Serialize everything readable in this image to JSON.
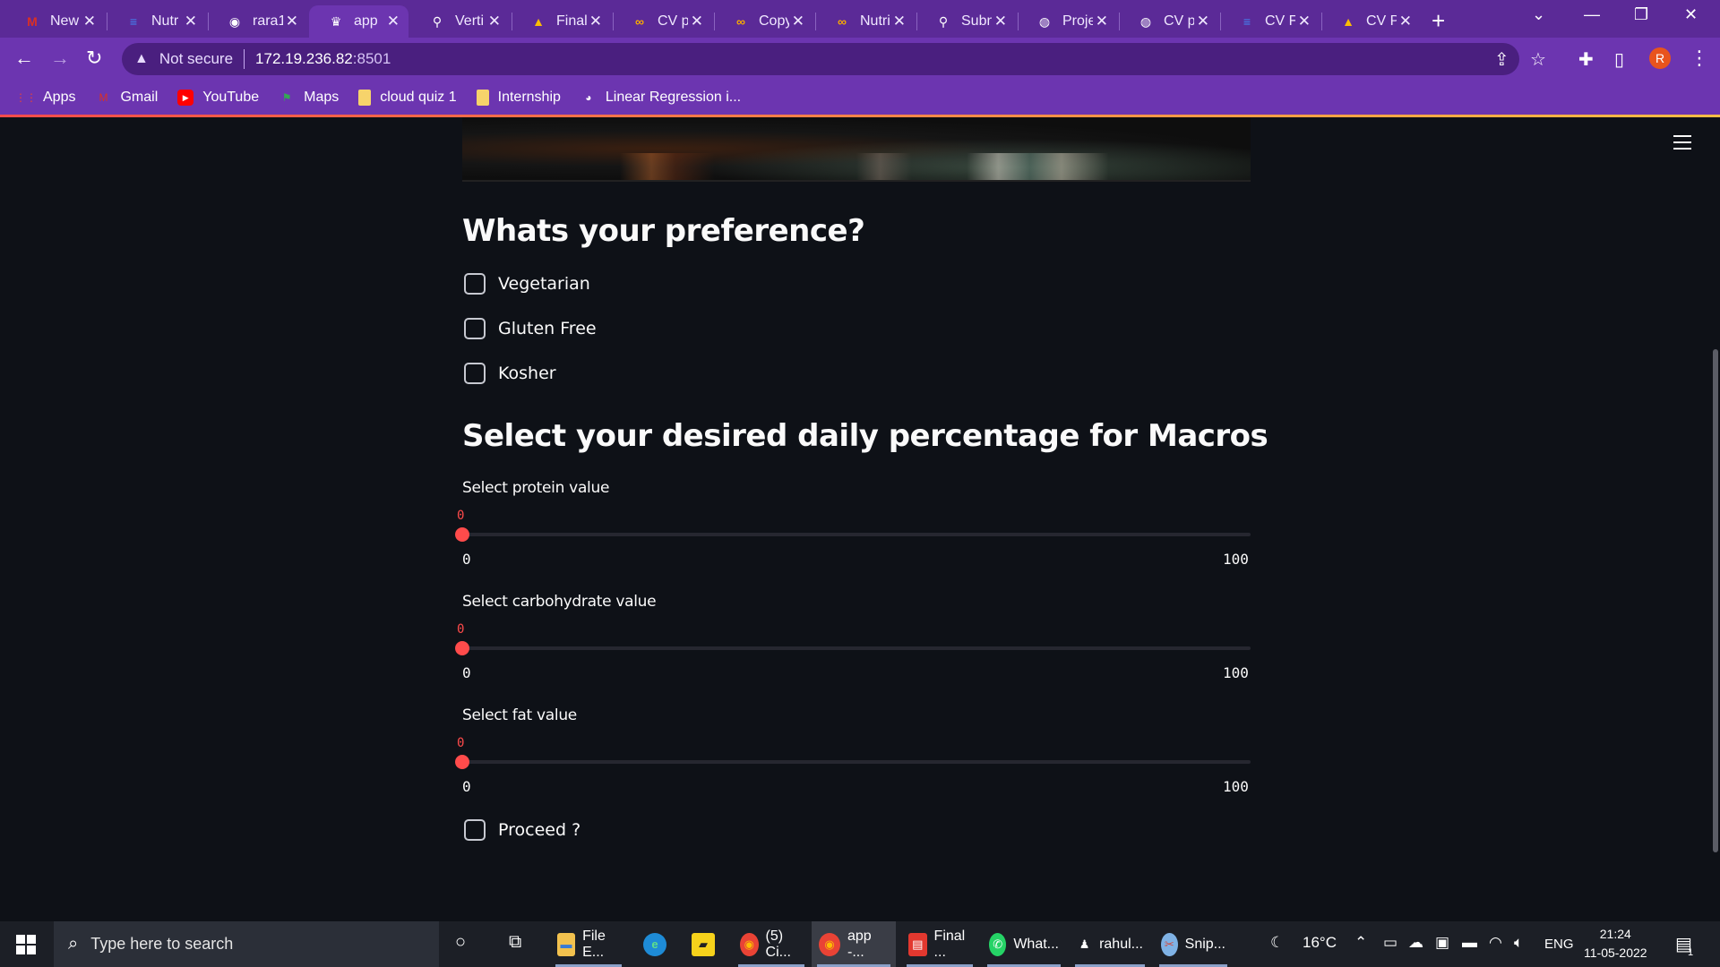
{
  "browser": {
    "tabs": [
      {
        "label": "New",
        "icon": "gmail-icon",
        "color": "#d93025"
      },
      {
        "label": "Nutr",
        "icon": "docs-icon",
        "color": "#4285f4"
      },
      {
        "label": "rara1",
        "icon": "github-icon",
        "color": "#ffffff"
      },
      {
        "label": "app",
        "icon": "streamlit-icon",
        "color": "#ffffff"
      },
      {
        "label": "Verti",
        "icon": "pin-icon",
        "color": "#ffffff"
      },
      {
        "label": "Final",
        "icon": "drive-icon",
        "color": "#fbbc04"
      },
      {
        "label": "CV p",
        "icon": "colab-icon",
        "color": "#f9ab00"
      },
      {
        "label": "Copy",
        "icon": "colab-icon",
        "color": "#f9ab00"
      },
      {
        "label": "Nutri",
        "icon": "colab-icon",
        "color": "#f9ab00"
      },
      {
        "label": "Subn",
        "icon": "pin-icon",
        "color": "#ffffff"
      },
      {
        "label": "Proje",
        "icon": "globe-icon",
        "color": "#ffffff"
      },
      {
        "label": "CV p",
        "icon": "globe-icon",
        "color": "#ffffff"
      },
      {
        "label": "CV F",
        "icon": "docs-icon",
        "color": "#4285f4"
      },
      {
        "label": "CV P",
        "icon": "drive-icon",
        "color": "#fbbc04"
      }
    ],
    "active_tab": 3,
    "address": {
      "security": "Not secure",
      "host": "172.19.236.82",
      "port": ":8501"
    },
    "profile_initial": "R",
    "bookmarks": [
      {
        "label": "Apps",
        "icon": "apps-grid-icon",
        "color": "#ea4335"
      },
      {
        "label": "Gmail",
        "icon": "gmail-icon",
        "color": "#d93025"
      },
      {
        "label": "YouTube",
        "icon": "youtube-icon",
        "color": "#ff0000"
      },
      {
        "label": "Maps",
        "icon": "maps-icon",
        "color": "#34a853"
      },
      {
        "label": "cloud quiz 1",
        "icon": "folder-icon",
        "color": "#f6d36b"
      },
      {
        "label": "Internship",
        "icon": "folder-icon",
        "color": "#f6d36b"
      },
      {
        "label": "Linear Regression i...",
        "icon": "python-icon",
        "color": "#ffffff"
      }
    ]
  },
  "app": {
    "preference_heading": "Whats your preference?",
    "preferences": [
      {
        "label": "Vegetarian",
        "checked": false
      },
      {
        "label": "Gluten Free",
        "checked": false
      },
      {
        "label": "Kosher",
        "checked": false
      }
    ],
    "macros_heading": "Select your desired daily percentage for Macros",
    "sliders": [
      {
        "label": "Select protein value",
        "value": 0,
        "min": 0,
        "max": 100
      },
      {
        "label": "Select carbohydrate value",
        "value": 0,
        "min": 0,
        "max": 100
      },
      {
        "label": "Select fat value",
        "value": 0,
        "min": 0,
        "max": 100
      }
    ],
    "proceed_label": "Proceed ?",
    "accent_color": "#ff4b4b"
  },
  "taskbar": {
    "search_placeholder": "Type here to search",
    "apps": [
      {
        "label": "File E...",
        "icon": "file-explorer-icon"
      },
      {
        "label": "",
        "icon": "edge-icon"
      },
      {
        "label": "",
        "icon": "sticky-notes-icon"
      },
      {
        "label": "(5) Ci...",
        "icon": "chrome-icon"
      },
      {
        "label": "app -...",
        "icon": "chrome-icon"
      },
      {
        "label": "Final ...",
        "icon": "pdf-icon"
      },
      {
        "label": "What...",
        "icon": "whatsapp-icon"
      },
      {
        "label": "rahul...",
        "icon": "linux-penguin-icon"
      },
      {
        "label": "Snip...",
        "icon": "snipping-tool-icon"
      }
    ],
    "weather": "16°C",
    "language": "ENG",
    "time": "21:24",
    "date": "11-05-2022",
    "notification_count": "1"
  }
}
